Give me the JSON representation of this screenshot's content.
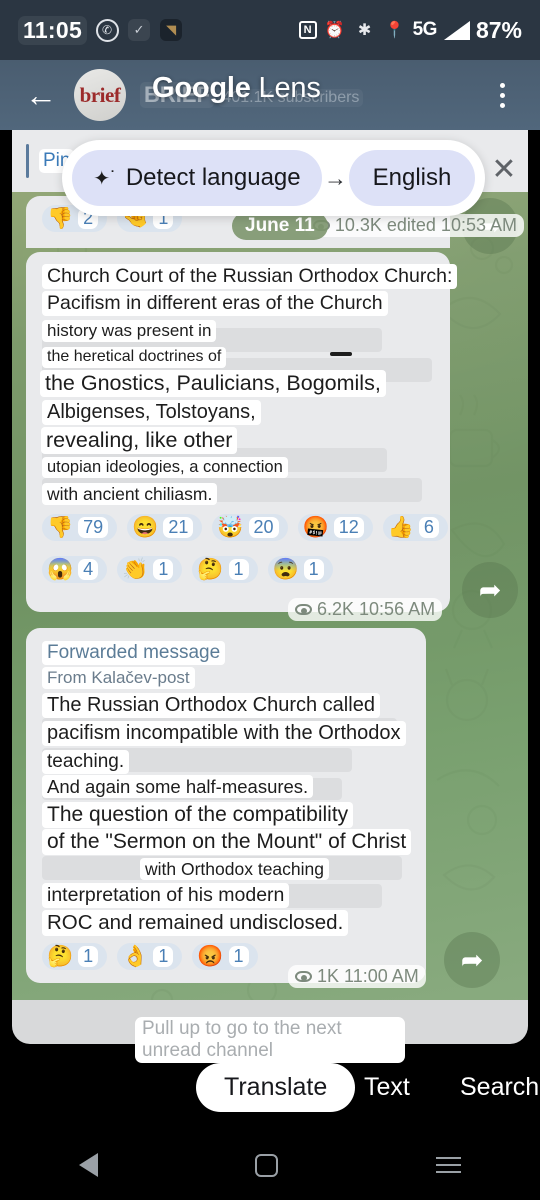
{
  "status_bar": {
    "time": "11:05",
    "left_icons": [
      "viber-icon",
      "check-square-icon",
      "dark-square-icon"
    ],
    "right_icons": [
      "nfc-icon",
      "alarm-icon",
      "bluetooth-icon",
      "location-icon"
    ],
    "network": "5G",
    "battery": "87%"
  },
  "header": {
    "back_label": "←",
    "avatar_text": "brief",
    "channel_name": "BRIEF",
    "subscribers": "401.1K subscribers",
    "lens_title_bold": "Google",
    "lens_title_light": " Lens"
  },
  "pinned": {
    "label": "Pin"
  },
  "lens_bar": {
    "source_language": "Detect language",
    "arrow": "→",
    "target_language": "English",
    "close_label": "✕"
  },
  "date_divider": "June 11",
  "messages": [
    {
      "id": "msg-top-partial",
      "reactions": [
        {
          "emoji": "👎",
          "count": "2"
        },
        {
          "emoji": "🤏",
          "count": "1"
        }
      ],
      "views": "10.3K",
      "edited_label": "edited 10:53 AM"
    },
    {
      "id": "msg-church-court",
      "lines": [
        "Church Court of the Russian Orthodox Church:",
        "Pacifism in different eras of the Church",
        "history was present in",
        "the heretical doctrines of",
        "the Gnostics, Paulicians, Bogomils,",
        "Albigenses, Tolstoyans,",
        "revealing, like other",
        "utopian ideologies, a connection",
        "with ancient chiliasm."
      ],
      "reactions_row1": [
        {
          "emoji": "👎",
          "count": "79"
        },
        {
          "emoji": "😄",
          "count": "21"
        },
        {
          "emoji": "🤯",
          "count": "20"
        },
        {
          "emoji": "🤬",
          "count": "12"
        },
        {
          "emoji": "👍",
          "count": "6"
        }
      ],
      "reactions_row2": [
        {
          "emoji": "😱",
          "count": "4"
        },
        {
          "emoji": "👏",
          "count": "1"
        },
        {
          "emoji": "🤔",
          "count": "1"
        },
        {
          "emoji": "😨",
          "count": "1"
        }
      ],
      "views": "6.2K",
      "time": "10:56 AM"
    },
    {
      "id": "msg-forwarded-kalacev",
      "forwarded_label": "Forwarded message",
      "forwarded_from": "From Kalačev-post",
      "lines": [
        "The Russian Orthodox Church called",
        "pacifism incompatible with the Orthodox",
        "teaching.",
        "And again some half-measures.",
        "The question of the compatibility",
        "of the \"Sermon on the Mount\" of Christ",
        "with Orthodox teaching",
        "interpretation of his modern",
        "ROC and remained undisclosed."
      ],
      "reactions_row1": [
        {
          "emoji": "🤔",
          "count": "1"
        },
        {
          "emoji": "👌",
          "count": "1"
        },
        {
          "emoji": "😡",
          "count": "1"
        }
      ],
      "views": "1K",
      "time": "11:00 AM"
    }
  ],
  "chat_footer_hint": "Pull up to go to the next unread channel",
  "bottom_bar": {
    "translate": "Translate",
    "text": "Text",
    "search": "Search"
  },
  "nav_bar": {
    "back": "back-icon",
    "home": "home-icon",
    "recents": "recents-icon"
  },
  "colors": {
    "header_bg": "#51677c",
    "status_bg": "#2b3642",
    "chat_green": "#7d9a6b",
    "bubble_bg": "#e9eaec",
    "chip_bg": "#dde1f7",
    "accent_blue": "#4a7fb5"
  }
}
